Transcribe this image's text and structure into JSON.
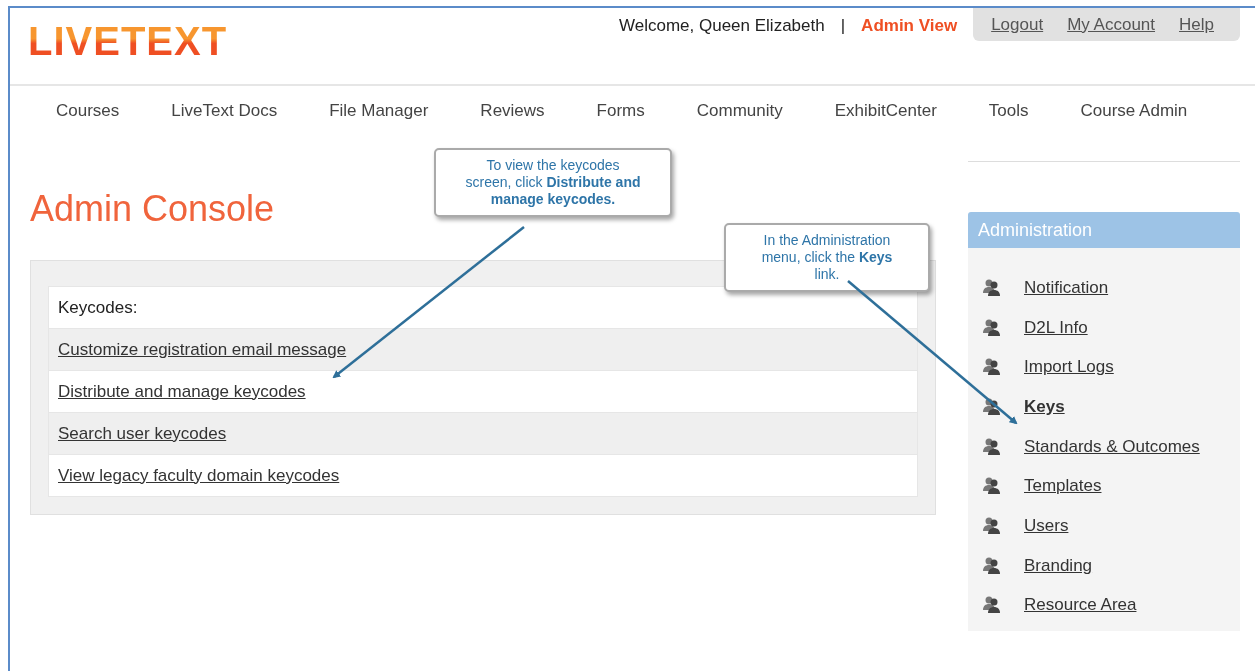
{
  "header": {
    "logo": "LIVETEXT",
    "welcome": "Welcome, Queen Elizabeth",
    "separator": "|",
    "view_link": "Admin View",
    "account_links": [
      "Logout",
      "My Account",
      "Help"
    ]
  },
  "nav": [
    "Courses",
    "LiveText Docs",
    "File Manager",
    "Reviews",
    "Forms",
    "Community",
    "ExhibitCenter",
    "Tools",
    "Course Admin"
  ],
  "page_title": "Admin Console",
  "keycodes": {
    "heading": "Keycodes:",
    "links": [
      "Customize registration email message",
      "Distribute and manage keycodes",
      "Search user keycodes",
      "View legacy faculty domain keycodes"
    ]
  },
  "sidebar": {
    "title": "Administration",
    "items": [
      {
        "label": "Notification",
        "selected": false
      },
      {
        "label": "D2L Info",
        "selected": false
      },
      {
        "label": "Import Logs",
        "selected": false
      },
      {
        "label": "Keys",
        "selected": true
      },
      {
        "label": "Standards & Outcomes",
        "selected": false
      },
      {
        "label": "Templates",
        "selected": false
      },
      {
        "label": "Users",
        "selected": false
      },
      {
        "label": "Branding",
        "selected": false
      },
      {
        "label": "Resource Area",
        "selected": false
      }
    ]
  },
  "callouts": [
    {
      "text": "To view the keycodes screen, click **Distribute and manage keycodes.**"
    },
    {
      "text": "In the Administration menu, click the **Keys** link."
    }
  ]
}
